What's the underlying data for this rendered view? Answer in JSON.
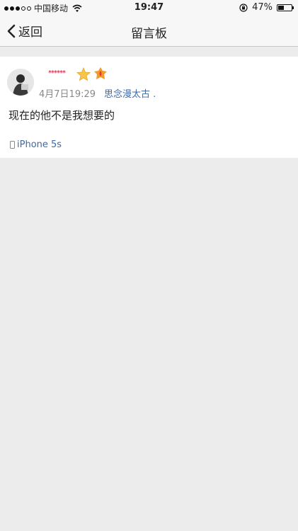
{
  "status_bar": {
    "carrier": "中国移动",
    "time": "19:47",
    "battery_percent": "47%",
    "battery_level": 0.47,
    "signal_dots_filled": 3,
    "signal_dots_total": 5
  },
  "nav": {
    "back_label": "返回",
    "title": "留言板"
  },
  "post": {
    "username": "******",
    "time": "4月7日19:29",
    "source": "思念漫太古 .",
    "content": "现在的他不是我想要的",
    "device": "iPhone 5s",
    "badges": [
      "star-badge-icon",
      "flame-badge-icon"
    ]
  },
  "colors": {
    "link": "#3b6aa8",
    "username": "#c8102e",
    "background": "#ececec"
  }
}
